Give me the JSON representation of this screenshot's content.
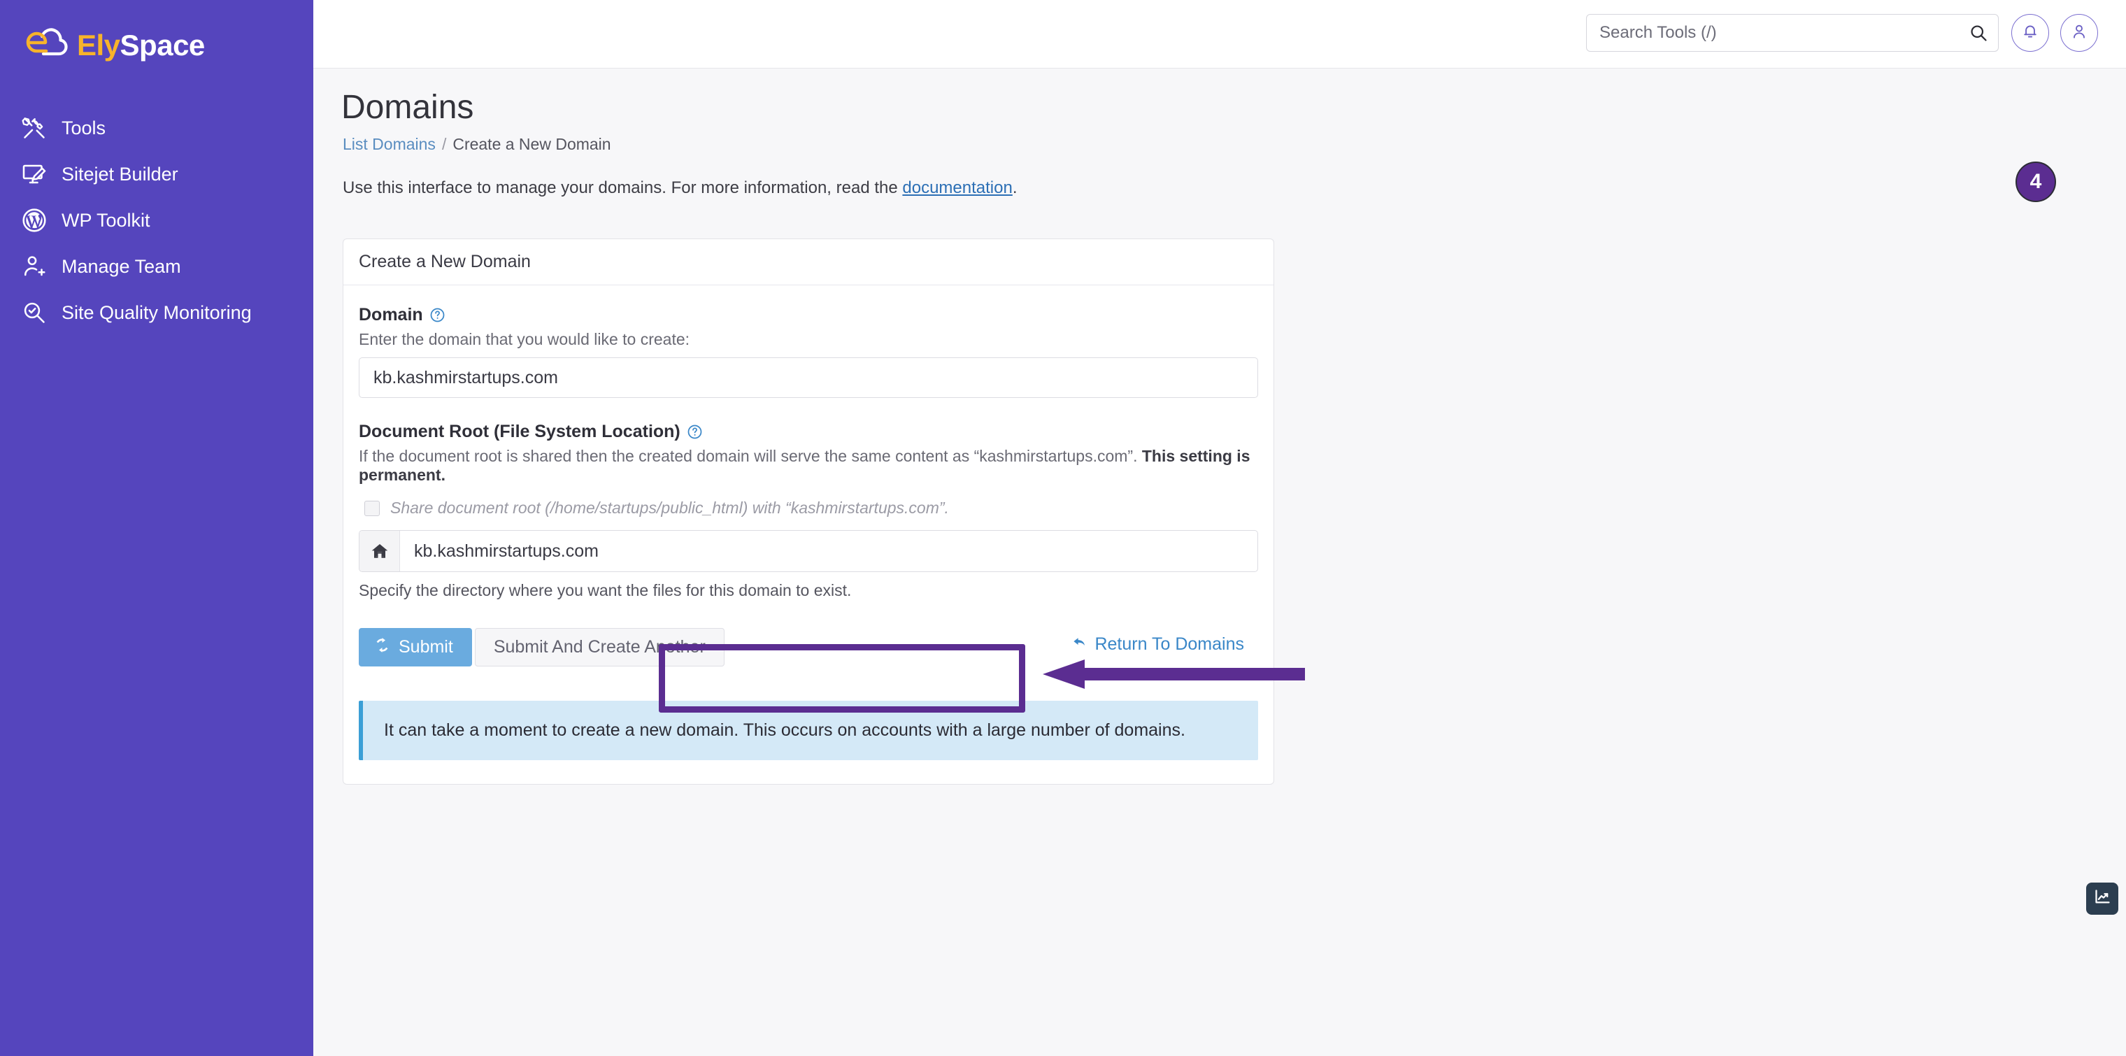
{
  "brand": {
    "name_part1": "Ely",
    "name_part2": "Space",
    "sidebar_color": "#5545bd",
    "accent_yellow": "#f7b32b"
  },
  "sidebar": {
    "items": [
      {
        "label": "Tools",
        "icon": "tools-icon"
      },
      {
        "label": "Sitejet Builder",
        "icon": "monitor-pencil-icon"
      },
      {
        "label": "WP Toolkit",
        "icon": "wordpress-icon"
      },
      {
        "label": "Manage Team",
        "icon": "user-add-icon"
      },
      {
        "label": "Site Quality Monitoring",
        "icon": "magnifier-check-icon"
      }
    ]
  },
  "topbar": {
    "search_placeholder": "Search Tools (/)",
    "search_value": "",
    "search_icon": "search-icon",
    "bell_icon": "bell-icon",
    "user_icon": "user-icon"
  },
  "page": {
    "title": "Domains",
    "breadcrumb": {
      "link": "List Domains",
      "separator": "/",
      "current": "Create a New Domain"
    },
    "intro_before": "Use this interface to manage your domains. For more information, read the ",
    "intro_link": "documentation",
    "intro_after": ".",
    "step_badge": "4",
    "step_badge_color": "#5b2d91"
  },
  "card": {
    "header": "Create a New Domain",
    "domain_field": {
      "label": "Domain",
      "help_icon": "question-circle-icon",
      "description": "Enter the domain that you would like to create:",
      "value": "kb.kashmirstartups.com",
      "placeholder": ""
    },
    "docroot_field": {
      "label": "Document Root (File System Location)",
      "help_icon": "question-circle-icon",
      "description_normal": "If the document root is shared then the created domain will serve the same content as “kashmirstartups.com”. ",
      "description_bold": "This setting is permanent.",
      "checkbox_label": "Share document root (/home/startups/public_html) with “kashmirstartups.com”.",
      "checkbox_checked": false,
      "addon_icon": "home-icon",
      "value": "kb.kashmirstartups.com",
      "hint": "Specify the directory where you want the files for this domain to exist."
    },
    "actions": {
      "submit_label": "Submit",
      "submit_icon": "refresh-icon",
      "submit_another_label": "Submit And Create Another",
      "return_label": "Return To Domains",
      "return_icon": "arrow-back-icon",
      "submit_color": "#6aabdf"
    },
    "alert": {
      "text": "It can take a moment to create a new domain. This occurs on accounts with a large number of domains.",
      "background": "#d4e9f7",
      "border": "#3b9fd6"
    }
  },
  "annotations": {
    "highlight_box_color": "#5b2d91",
    "arrow_color": "#5b2d91",
    "arrow_direction": "left"
  },
  "float_widget": {
    "icon": "chart-line-icon",
    "color": "#2c3e50"
  }
}
